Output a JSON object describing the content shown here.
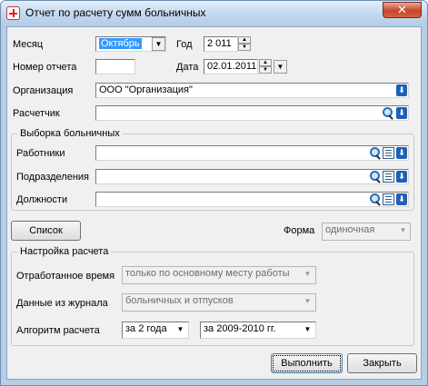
{
  "window": {
    "title": "Отчет по расчету сумм больничных",
    "close_label": "✕"
  },
  "form": {
    "month_label": "Месяц",
    "month_value": "Октябрь",
    "year_label": "Год",
    "year_value": "2 011",
    "report_no_label": "Номер отчета",
    "report_no_value": "",
    "date_label": "Дата",
    "date_value": "02.01.2011",
    "org_label": "Организация",
    "org_value": "ООО \"Организация\"",
    "calc_label": "Расчетчик",
    "calc_value": ""
  },
  "selection": {
    "title": "Выборка больничных",
    "employees_label": "Работники",
    "departments_label": "Подразделения",
    "positions_label": "Должности"
  },
  "list_button": "Список",
  "form_type": {
    "label": "Форма",
    "value": "одиночная"
  },
  "settings": {
    "title": "Настройка расчета",
    "worked_time_label": "Отработанное время",
    "worked_time_value": "только по основному месту работы",
    "journal_label": "Данные из журнала",
    "journal_value": "больничных и отпусков",
    "algorithm_label": "Алгоритм расчета",
    "algorithm_value": "за 2 года",
    "period_value": "за 2009-2010 гг."
  },
  "buttons": {
    "run": "Выполнить",
    "close": "Закрыть"
  }
}
